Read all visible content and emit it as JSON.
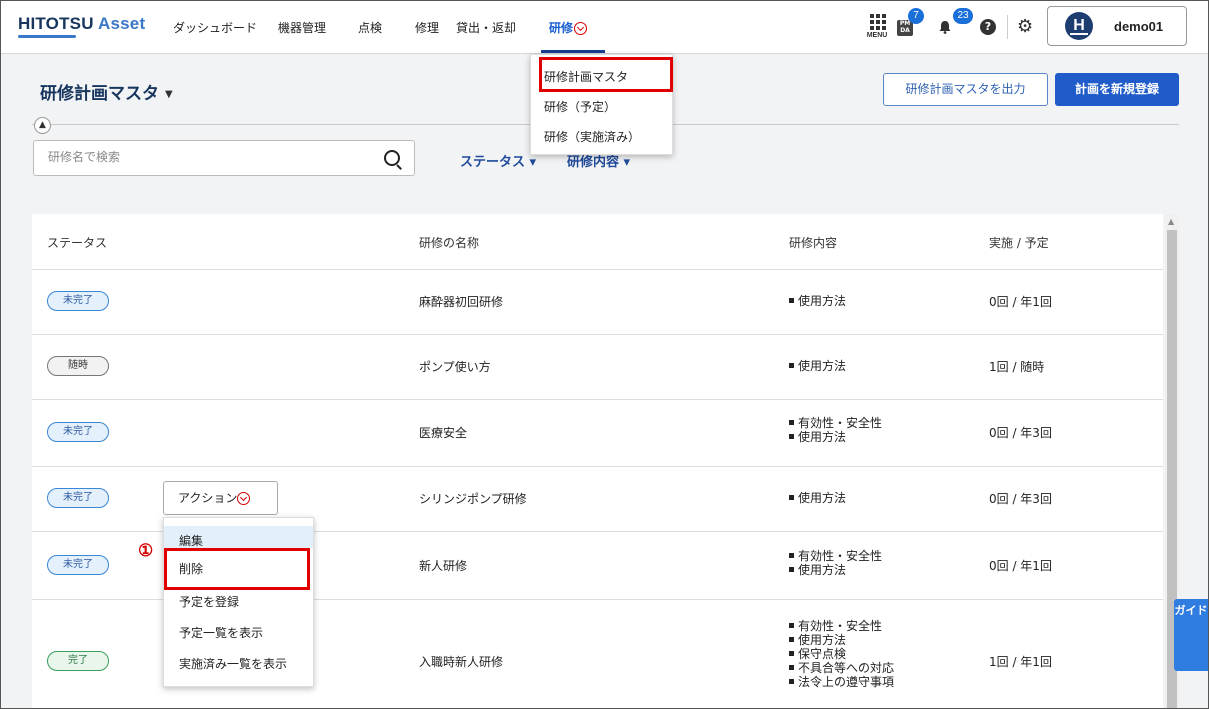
{
  "app": {
    "logo_main": "HITOTSU",
    "logo_sub": "Asset",
    "username": "demo01",
    "avatar_letter": "H"
  },
  "nav": {
    "items": [
      "ダッシュボード",
      "機器管理",
      "点検",
      "修理",
      "貸出・返却",
      "研修"
    ],
    "active": "研修",
    "menu_label": "MENU",
    "pmda_label": "PM DA",
    "pmda_badge": "7",
    "notifications_badge": "23",
    "help_label": "?"
  },
  "training_menu": {
    "items": [
      "研修計画マスタ",
      "研修（予定）",
      "研修（実施済み）"
    ]
  },
  "page": {
    "title": "研修計画マスタ",
    "export_button": "研修計画マスタを出力",
    "new_button": "計画を新規登録",
    "search_placeholder": "研修名で検索",
    "filter_status": "ステータス ▾",
    "filter_contents": "研修内容 ▾"
  },
  "table": {
    "headers": [
      "ステータス",
      "研修の名称",
      "研修内容",
      "実施 / 予定"
    ],
    "rows": [
      {
        "status": "未完了",
        "name": "麻酔器初回研修",
        "contents": [
          "使用方法"
        ],
        "count": "0回 / 年1回"
      },
      {
        "status": "随時",
        "name": "ポンプ使い方",
        "contents": [
          "使用方法"
        ],
        "count": "1回 / 随時"
      },
      {
        "status": "未完了",
        "name": "医療安全",
        "contents": [
          "有効性・安全性",
          "使用方法"
        ],
        "count": "0回 / 年3回"
      },
      {
        "status": "未完了",
        "name": "シリンジポンプ研修",
        "contents": [
          "使用方法"
        ],
        "count": "0回 / 年3回"
      },
      {
        "status": "未完了",
        "name": "新人研修",
        "contents": [
          "有効性・安全性",
          "使用方法"
        ],
        "count": "0回 / 年1回"
      },
      {
        "status": "完了",
        "name": "入職時新人研修",
        "contents": [
          "有効性・安全性",
          "使用方法",
          "保守点検",
          "不具合等への対応",
          "法令上の遵守事項"
        ],
        "count": "1回 / 年1回"
      }
    ]
  },
  "action_menu": {
    "button_label": "アクション",
    "items": [
      "編集",
      "削除",
      "予定を登録",
      "予定一覧を表示",
      "実施済み一覧を表示"
    ]
  },
  "annotation": {
    "callout": "①"
  },
  "guide_tab": "ガイド",
  "colors": {
    "brand": "#17365d",
    "primary": "#1f5cc9",
    "highlight": "#e00000"
  }
}
